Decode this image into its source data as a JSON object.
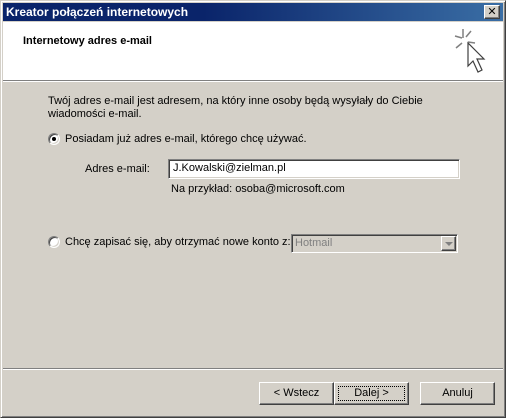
{
  "window": {
    "title": "Kreator połączeń internetowych",
    "close_glyph": "✕"
  },
  "header": {
    "title": "Internetowy adres e-mail",
    "icon": "wizard-wand-icon"
  },
  "intro": "Twój adres e-mail jest adresem, na który inne osoby będą wysyłały do Ciebie wiadomości e-mail.",
  "option_existing": {
    "label": "Posiadam już adres e-mail, którego chcę używać.",
    "selected": true
  },
  "email": {
    "label": "Adres e-mail:",
    "value": "J.Kowalski@zielman.pl",
    "example": "Na przykład: osoba@microsoft.com"
  },
  "option_new": {
    "label": "Chcę zapisać się, aby otrzymać nowe konto z:",
    "selected": false,
    "provider": "Hotmail"
  },
  "buttons": {
    "back": "< Wstecz",
    "next": "Dalej >",
    "cancel": "Anuluj"
  }
}
